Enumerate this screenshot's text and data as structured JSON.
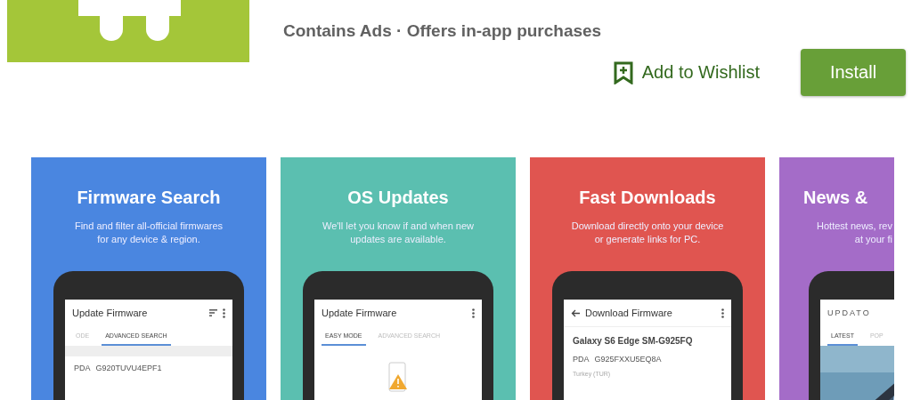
{
  "meta": "Contains Ads · Offers in-app purchases",
  "wishlist": "Add to Wishlist",
  "install": "Install",
  "screenshots": [
    {
      "color": "#4a86e0",
      "title": "Firmware Search",
      "subtitle": [
        "Find and filter all-official firmwares",
        "for any device & region."
      ],
      "screen": {
        "kind": "search",
        "title": "Update Firmware",
        "tabs": [
          {
            "label": "ODE",
            "selected": false
          },
          {
            "label": "ADVANCED SEARCH",
            "selected": true
          }
        ],
        "label": "PDA",
        "code": "G920TUVU4EPF1"
      }
    },
    {
      "color": "#5bbfb0",
      "title": "OS Updates",
      "subtitle": [
        "We'll let you know if and when new",
        "updates are available."
      ],
      "screen": {
        "kind": "empty",
        "title": "Update Firmware",
        "tabs": [
          {
            "label": "EASY MODE",
            "selected": true
          },
          {
            "label": "ADVANCED SEARCH",
            "selected": false
          }
        ]
      }
    },
    {
      "color": "#e05550",
      "title": "Fast Downloads",
      "subtitle": [
        "Download directly onto your device",
        "or generate links for PC."
      ],
      "screen": {
        "kind": "download",
        "title": "Download Firmware",
        "device": "Galaxy S6 Edge SM-G925FQ",
        "label": "PDA",
        "code": "G925FXXU5EQ8A",
        "region": "Turkey (TUR)"
      }
    },
    {
      "color": "#a46cc8",
      "title": "News &",
      "subtitle": [
        "Hottest news, rev",
        "at your fi"
      ],
      "screen": {
        "kind": "news",
        "logo": "UPDATO",
        "tabs": [
          {
            "label": "LATEST",
            "selected": true
          },
          {
            "label": "POP",
            "selected": false
          }
        ]
      }
    }
  ]
}
